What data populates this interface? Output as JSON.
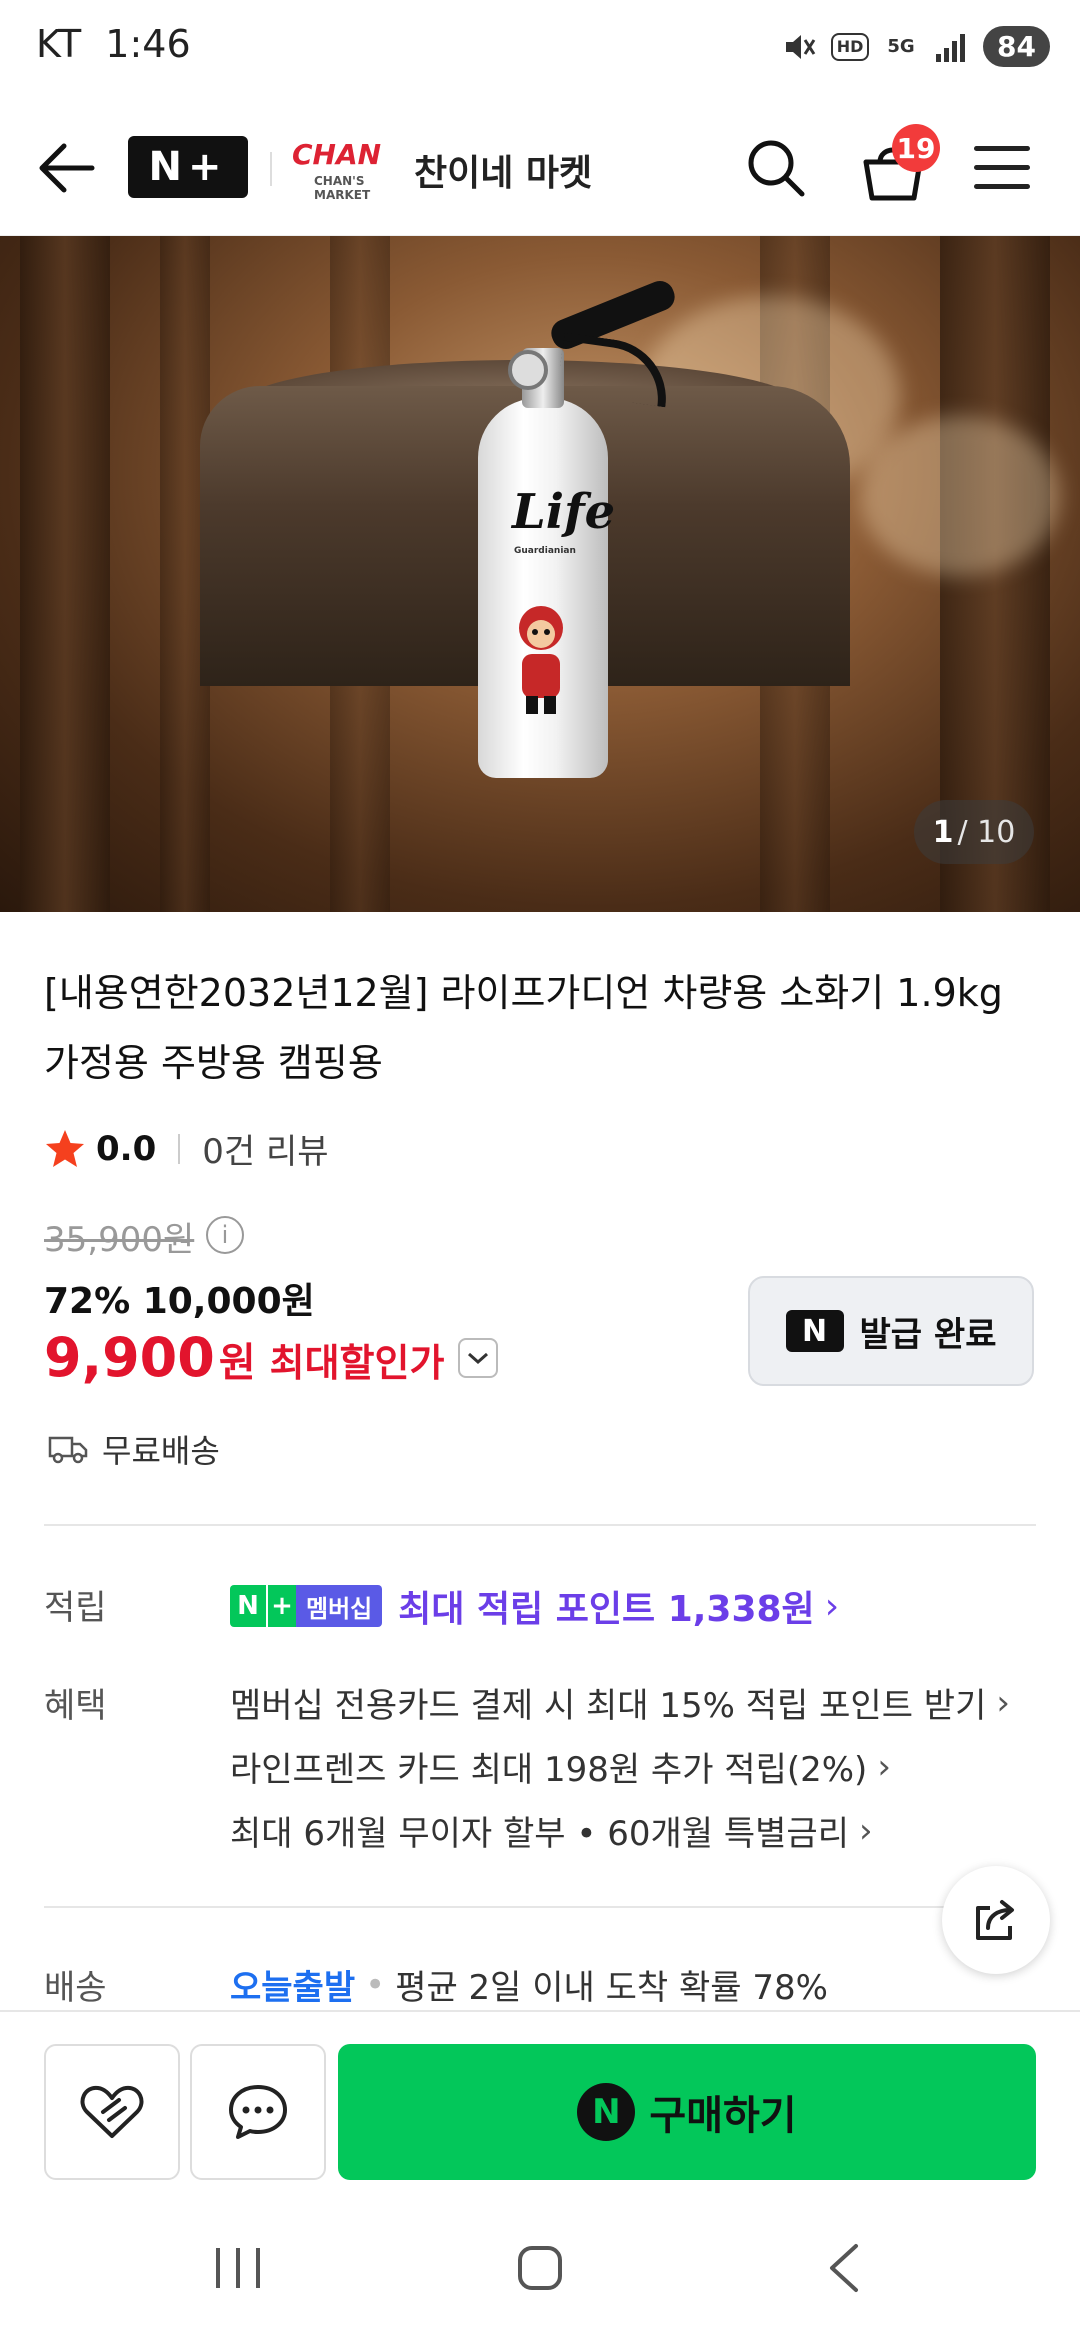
{
  "status_bar": {
    "carrier": "KT",
    "time": "1:46",
    "network": "5G",
    "hd": "HD",
    "battery": "84"
  },
  "header": {
    "nplus_logo": "N+",
    "store_logo_text": "CHAN",
    "store_logo_sub": "CHAN'S MARKET",
    "store_name": "찬이네 마켓",
    "cart_count": "19"
  },
  "hero": {
    "image_label": "Life",
    "image_sub": "Guardianian",
    "counter_current": "1",
    "counter_total": "/ 10"
  },
  "product": {
    "title": "[내용연한2032년12월] 라이프가디언 차량용 소화기 1.9kg 가정용 주방용 캠핑용",
    "rating": "0.0",
    "review_count": "0건 리뷰",
    "original_price": "35,900원",
    "discount_line": "72% 10,000원",
    "final_price": "9,900",
    "final_unit": "원",
    "final_label": "최대할인가",
    "coupon_label": "발급 완료",
    "coupon_icon_letter": "N",
    "shipping": "무료배송"
  },
  "points": {
    "label": "적립",
    "badge_n": "N",
    "badge_plus": "+",
    "badge_member": "멤버십",
    "text": "최대 적립 포인트 1,338원",
    "chevron": "›"
  },
  "benefits": {
    "label": "혜택",
    "items": [
      "멤버십 전용카드 결제 시 최대 15% 적립 포인트 받기",
      "라인프렌즈 카드 최대 198원 추가 적립(2%)",
      "최대 6개월 무이자 할부 • 60개월 특별금리"
    ],
    "chevron": "›"
  },
  "delivery": {
    "label": "배송",
    "today": "오늘출발",
    "dot": "•",
    "desc": "평균 2일 이내 도착 확률 78%"
  },
  "bottom_bar": {
    "buy_icon_letter": "N",
    "buy_label": "구매하기"
  },
  "colors": {
    "naver_green": "#03c75a",
    "price_red": "#e2142d",
    "points_purple": "#6b3ee8",
    "delivery_blue": "#1d6ff0"
  }
}
